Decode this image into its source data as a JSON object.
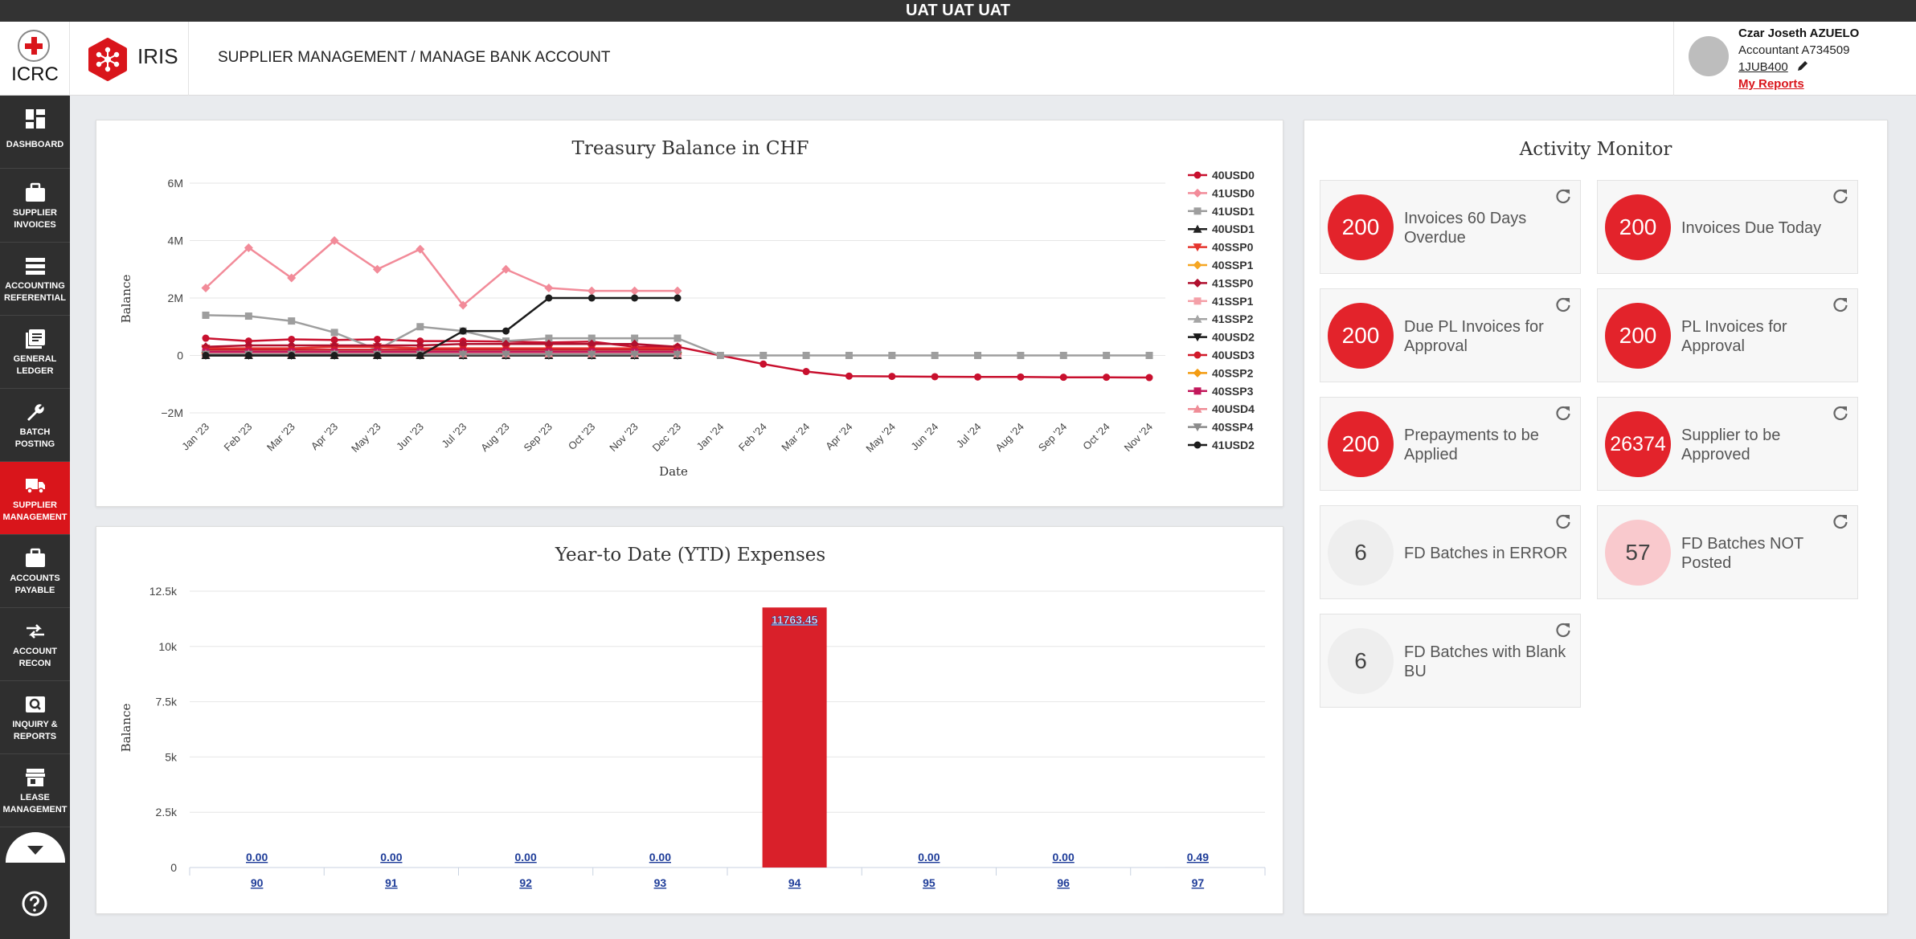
{
  "env_banner": "UAT UAT UAT",
  "header": {
    "org_logo": "ICRC",
    "app_name": "IRIS",
    "breadcrumb": "SUPPLIER MANAGEMENT / MANAGE BANK ACCOUNT",
    "user": {
      "name": "Czar Joseth AZUELO",
      "role": "Accountant A734509",
      "business_unit": "1JUB400",
      "reports_link": "My Reports"
    }
  },
  "sidebar": {
    "items": [
      {
        "label": "DASHBOARD",
        "icon": "dashboard-icon"
      },
      {
        "label": "SUPPLIER INVOICES",
        "icon": "briefcase-icon"
      },
      {
        "label": "ACCOUNTING REFERENTIAL",
        "icon": "list-icon"
      },
      {
        "label": "GENERAL LEDGER",
        "icon": "ledger-icon"
      },
      {
        "label": "BATCH POSTING",
        "icon": "wrench-icon"
      },
      {
        "label": "SUPPLIER MANAGEMENT",
        "icon": "truck-icon",
        "active": true
      },
      {
        "label": "ACCOUNTS PAYABLE",
        "icon": "briefcase-icon"
      },
      {
        "label": "ACCOUNT RECON",
        "icon": "arrows-icon"
      },
      {
        "label": "INQUIRY & REPORTS",
        "icon": "search-icon"
      },
      {
        "label": "LEASE MANAGEMENT",
        "icon": "store-icon"
      }
    ]
  },
  "treasury": {
    "title": "Treasury Balance in CHF",
    "ylabel": "Balance",
    "xlabel": "Date"
  },
  "ytd": {
    "title": "Year-to Date (YTD) Expenses",
    "ylabel": "Balance"
  },
  "activity": {
    "title": "Activity Monitor",
    "cards": [
      {
        "value": "200",
        "label": "Invoices 60 Days Overdue",
        "style": "red"
      },
      {
        "value": "200",
        "label": "Invoices Due Today",
        "style": "red"
      },
      {
        "value": "200",
        "label": "Due PL Invoices for Approval",
        "style": "red"
      },
      {
        "value": "200",
        "label": "PL Invoices for Approval",
        "style": "red"
      },
      {
        "value": "200",
        "label": "Prepayments to be Applied",
        "style": "red"
      },
      {
        "value": "26374",
        "label": "Supplier to be Approved",
        "style": "red"
      },
      {
        "value": "6",
        "label": "FD Batches in ERROR",
        "style": "grey"
      },
      {
        "value": "57",
        "label": "FD Batches NOT Posted",
        "style": "pink"
      },
      {
        "value": "6",
        "label": "FD Batches with Blank BU",
        "style": "grey"
      }
    ]
  },
  "chart_data": [
    {
      "type": "line",
      "title": "Treasury Balance in CHF",
      "xlabel": "Date",
      "ylabel": "Balance",
      "x": [
        "Jan '23",
        "Feb '23",
        "Mar '23",
        "Apr '23",
        "May '23",
        "Jun '23",
        "Jul '23",
        "Aug '23",
        "Sep '23",
        "Oct '23",
        "Nov '23",
        "Dec '23",
        "Jan '24",
        "Feb '24",
        "Mar '24",
        "Apr '24",
        "May '24",
        "Jun '24",
        "Jul '24",
        "Aug '24",
        "Sep '24",
        "Oct '24",
        "Nov '24"
      ],
      "y_ticks": [
        "6M",
        "4M",
        "2M",
        "0",
        "−2M"
      ],
      "ylim": [
        -2000000,
        6000000
      ],
      "legend_position": "right",
      "series": [
        {
          "name": "40USD0",
          "color": "#c8102e",
          "marker": "circle",
          "values": [
            600000,
            500000,
            560000,
            540000,
            560000,
            500000,
            500000,
            480000,
            450000,
            480000,
            300000,
            300000,
            0,
            -300000,
            -560000,
            -720000,
            -730000,
            -740000,
            -750000,
            -750000,
            -760000,
            -760000,
            -770000
          ]
        },
        {
          "name": "41USD0",
          "color": "#f28b99",
          "marker": "diamond",
          "values": [
            2350000,
            3750000,
            2700000,
            4000000,
            3000000,
            3700000,
            1750000,
            3000000,
            2350000,
            2250000,
            2250000,
            2250000,
            null,
            null,
            null,
            null,
            null,
            null,
            null,
            null,
            null,
            null,
            null
          ]
        },
        {
          "name": "41USD1",
          "color": "#9e9e9e",
          "marker": "square",
          "values": [
            1400000,
            1370000,
            1200000,
            800000,
            200000,
            1000000,
            850000,
            500000,
            600000,
            600000,
            600000,
            600000,
            0,
            0,
            0,
            0,
            0,
            0,
            0,
            0,
            0,
            0,
            0
          ]
        },
        {
          "name": "40USD1",
          "color": "#222222",
          "marker": "triangle",
          "values": [
            0,
            0,
            0,
            0,
            0,
            0,
            0,
            0,
            0,
            0,
            0,
            0,
            null,
            null,
            null,
            null,
            null,
            null,
            null,
            null,
            null,
            null,
            null
          ]
        },
        {
          "name": "40SSP0",
          "color": "#e5352e",
          "marker": "triangle-down",
          "values": [
            250000,
            250000,
            250000,
            300000,
            300000,
            250000,
            250000,
            250000,
            250000,
            250000,
            250000,
            250000,
            null,
            null,
            null,
            null,
            null,
            null,
            null,
            null,
            null,
            null,
            null
          ]
        },
        {
          "name": "40SSP1",
          "color": "#f5a623",
          "marker": "diamond",
          "values": [
            50000,
            50000,
            50000,
            50000,
            50000,
            50000,
            50000,
            50000,
            50000,
            50000,
            50000,
            50000,
            null,
            null,
            null,
            null,
            null,
            null,
            null,
            null,
            null,
            null,
            null
          ]
        },
        {
          "name": "41SSP0",
          "color": "#b0102e",
          "marker": "diamond",
          "values": [
            300000,
            350000,
            350000,
            350000,
            350000,
            350000,
            400000,
            400000,
            400000,
            400000,
            400000,
            300000,
            null,
            null,
            null,
            null,
            null,
            null,
            null,
            null,
            null,
            null,
            null
          ]
        },
        {
          "name": "41SSP1",
          "color": "#f4a0a8",
          "marker": "square",
          "values": [
            100000,
            100000,
            100000,
            100000,
            100000,
            100000,
            100000,
            100000,
            100000,
            100000,
            100000,
            100000,
            null,
            null,
            null,
            null,
            null,
            null,
            null,
            null,
            null,
            null,
            null
          ]
        },
        {
          "name": "41SSP2",
          "color": "#a5a5a5",
          "marker": "triangle",
          "values": [
            150000,
            150000,
            150000,
            150000,
            150000,
            150000,
            150000,
            150000,
            150000,
            150000,
            150000,
            150000,
            null,
            null,
            null,
            null,
            null,
            null,
            null,
            null,
            null,
            null,
            null
          ]
        },
        {
          "name": "40USD2",
          "color": "#1a1a1a",
          "marker": "triangle-down",
          "values": [
            0,
            0,
            0,
            0,
            0,
            0,
            0,
            0,
            0,
            0,
            0,
            0,
            null,
            null,
            null,
            null,
            null,
            null,
            null,
            null,
            null,
            null,
            null
          ]
        },
        {
          "name": "40USD3",
          "color": "#d11a2a",
          "marker": "circle",
          "values": [
            200000,
            200000,
            200000,
            200000,
            200000,
            200000,
            200000,
            200000,
            200000,
            200000,
            200000,
            200000,
            null,
            null,
            null,
            null,
            null,
            null,
            null,
            null,
            null,
            null,
            null
          ]
        },
        {
          "name": "40SSP2",
          "color": "#f39c12",
          "marker": "diamond",
          "values": [
            80000,
            80000,
            80000,
            80000,
            80000,
            80000,
            80000,
            80000,
            80000,
            80000,
            80000,
            80000,
            null,
            null,
            null,
            null,
            null,
            null,
            null,
            null,
            null,
            null,
            null
          ]
        },
        {
          "name": "40SSP3",
          "color": "#c2185b",
          "marker": "square",
          "values": [
            120000,
            120000,
            120000,
            120000,
            120000,
            120000,
            120000,
            120000,
            120000,
            120000,
            120000,
            120000,
            null,
            null,
            null,
            null,
            null,
            null,
            null,
            null,
            null,
            null,
            null
          ]
        },
        {
          "name": "40USD4",
          "color": "#ef8c96",
          "marker": "triangle",
          "values": [
            60000,
            60000,
            60000,
            60000,
            60000,
            60000,
            60000,
            60000,
            60000,
            60000,
            60000,
            60000,
            null,
            null,
            null,
            null,
            null,
            null,
            null,
            null,
            null,
            null,
            null
          ]
        },
        {
          "name": "40SSP4",
          "color": "#8c8c8c",
          "marker": "triangle-down",
          "values": [
            40000,
            40000,
            40000,
            40000,
            40000,
            40000,
            40000,
            40000,
            40000,
            40000,
            40000,
            40000,
            null,
            null,
            null,
            null,
            null,
            null,
            null,
            null,
            null,
            null,
            null
          ]
        },
        {
          "name": "41USD2",
          "color": "#1c1c1c",
          "marker": "circle",
          "values": [
            0,
            0,
            0,
            0,
            0,
            0,
            850000,
            850000,
            2000000,
            2000000,
            2000000,
            2000000,
            null,
            null,
            null,
            null,
            null,
            null,
            null,
            null,
            null,
            null,
            null
          ]
        }
      ]
    },
    {
      "type": "bar",
      "title": "Year-to Date (YTD) Expenses",
      "ylabel": "Balance",
      "categories": [
        "90",
        "91",
        "92",
        "93",
        "94",
        "95",
        "96",
        "97"
      ],
      "values": [
        0,
        0,
        0,
        0,
        11763.45,
        0,
        0,
        0.49
      ],
      "data_labels": [
        "0.00",
        "0.00",
        "0.00",
        "0.00",
        "11763.45",
        "0.00",
        "0.00",
        "0.49"
      ],
      "y_ticks": [
        "12.5k",
        "10k",
        "7.5k",
        "5k",
        "2.5k",
        "0"
      ],
      "ylim": [
        0,
        12500
      ],
      "bar_color": "#d9202a"
    }
  ]
}
